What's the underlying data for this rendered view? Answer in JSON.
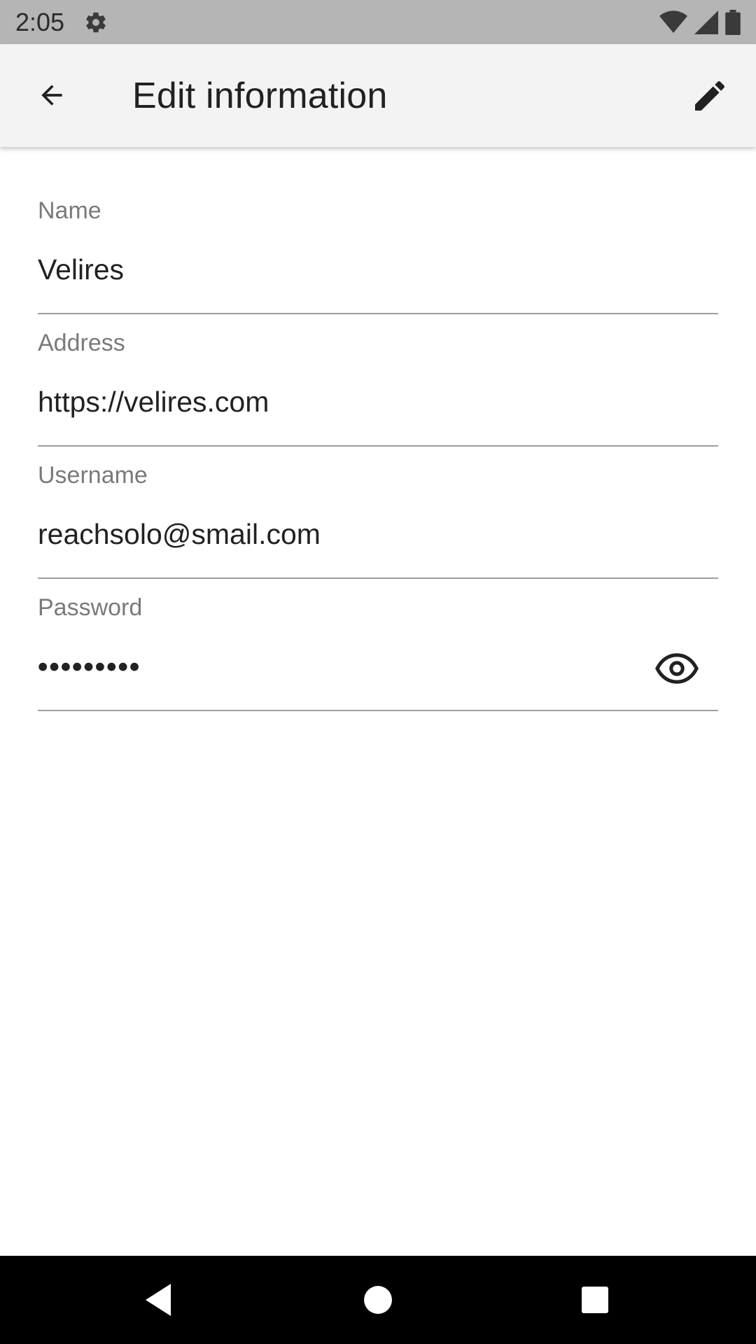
{
  "status_bar": {
    "time": "2:05",
    "icons": [
      "settings-icon",
      "wifi-icon",
      "signal-icon",
      "battery-icon"
    ]
  },
  "app_bar": {
    "title": "Edit information",
    "back_icon": "arrow-left-icon",
    "edit_icon": "pencil-icon"
  },
  "form": {
    "name": {
      "label": "Name",
      "value": "Velires"
    },
    "address": {
      "label": "Address",
      "value": "https://velires.com"
    },
    "username": {
      "label": "Username",
      "value": "reachsolo@smail.com"
    },
    "password": {
      "label": "Password",
      "value": "•••••••••",
      "toggle_icon": "eye-icon"
    }
  },
  "nav_bar": {
    "icons": [
      "back-triangle-icon",
      "home-circle-icon",
      "recents-square-icon"
    ]
  },
  "colors": {
    "status_bar_bg": "#b5b5b5",
    "app_bar_bg": "#f3f3f3",
    "label": "#7a7a7a",
    "value": "#222222",
    "divider": "#9e9e9e",
    "nav_bar_bg": "#000000"
  }
}
